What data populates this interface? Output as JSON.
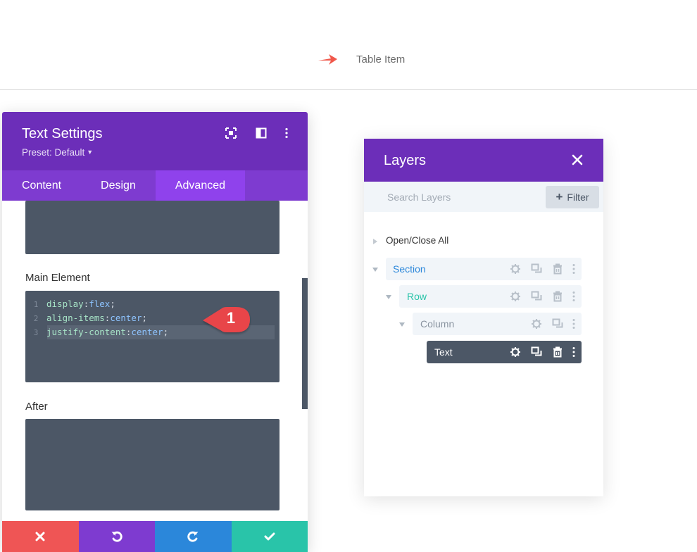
{
  "top": {
    "item_label": "Table Item",
    "arrow_icon": "arrow-right-icon",
    "arrow_color": "#f0584b"
  },
  "settings": {
    "title": "Text Settings",
    "preset": "Preset: Default",
    "tabs": [
      {
        "label": "Content",
        "active": false
      },
      {
        "label": "Design",
        "active": false
      },
      {
        "label": "Advanced",
        "active": true
      }
    ],
    "main_element_label": "Main Element",
    "after_label": "After",
    "code_lines": [
      {
        "num": "1",
        "prop": "display",
        "colon": ":",
        "value": "flex",
        "end": ";"
      },
      {
        "num": "2",
        "prop": "align-items",
        "colon": ":",
        "value": "center",
        "end": ";"
      },
      {
        "num": "3",
        "prop": "justify-content",
        "colon": ":",
        "value": "center",
        "end": ";"
      }
    ],
    "callout_number": "1",
    "colors": {
      "header": "#6c2eb9",
      "tabs": "#7e3bd0",
      "active_tab": "#8f42ec",
      "code_bg": "#4c5766",
      "cancel": "#ef5555",
      "undo": "#7e3bd0",
      "redo": "#2b87da",
      "save": "#29c4a9"
    }
  },
  "layers": {
    "title": "Layers",
    "search_placeholder": "Search Layers",
    "filter_label": "Filter",
    "open_close_label": "Open/Close All",
    "items": [
      {
        "label": "Section",
        "color": "#2b87da"
      },
      {
        "label": "Row",
        "color": "#29c4a9"
      },
      {
        "label": "Column",
        "color": "#8a94a0"
      },
      {
        "label": "Text",
        "color": "#ffffff"
      }
    ]
  }
}
